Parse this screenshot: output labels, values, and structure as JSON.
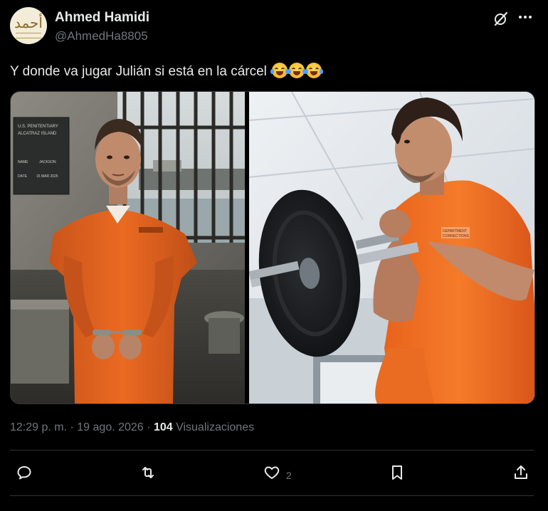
{
  "author": {
    "name": "Ahmed Hamidi",
    "handle": "@AhmedHa8805"
  },
  "post": {
    "text": "Y donde va jugar Julián si está en la cárcel",
    "emoji_count": 3,
    "emoji": "face-with-tears-of-joy"
  },
  "media": {
    "left_image": "man in orange prison uniform handcuffed in a cell",
    "right_image": "man in orange prison uniform lifting a barbell",
    "sign_lines": [
      "U.S. PENITENTIARY",
      "ALCATRAZ ISLAND",
      "NAME",
      "DATE"
    ],
    "sign_values": [
      "JACKSON",
      "15 MAR 2025"
    ]
  },
  "meta": {
    "time": "12:29 p. m.",
    "separator": "·",
    "date": "19 ago. 2026",
    "views_count": "104",
    "views_label": "Visualizaciones"
  },
  "actions": {
    "like_count": "2"
  },
  "colors": {
    "background": "#000000",
    "text": "#e7e9ea",
    "secondary": "#71767b",
    "divider": "#2f3336",
    "uniform": "#e9661f"
  }
}
